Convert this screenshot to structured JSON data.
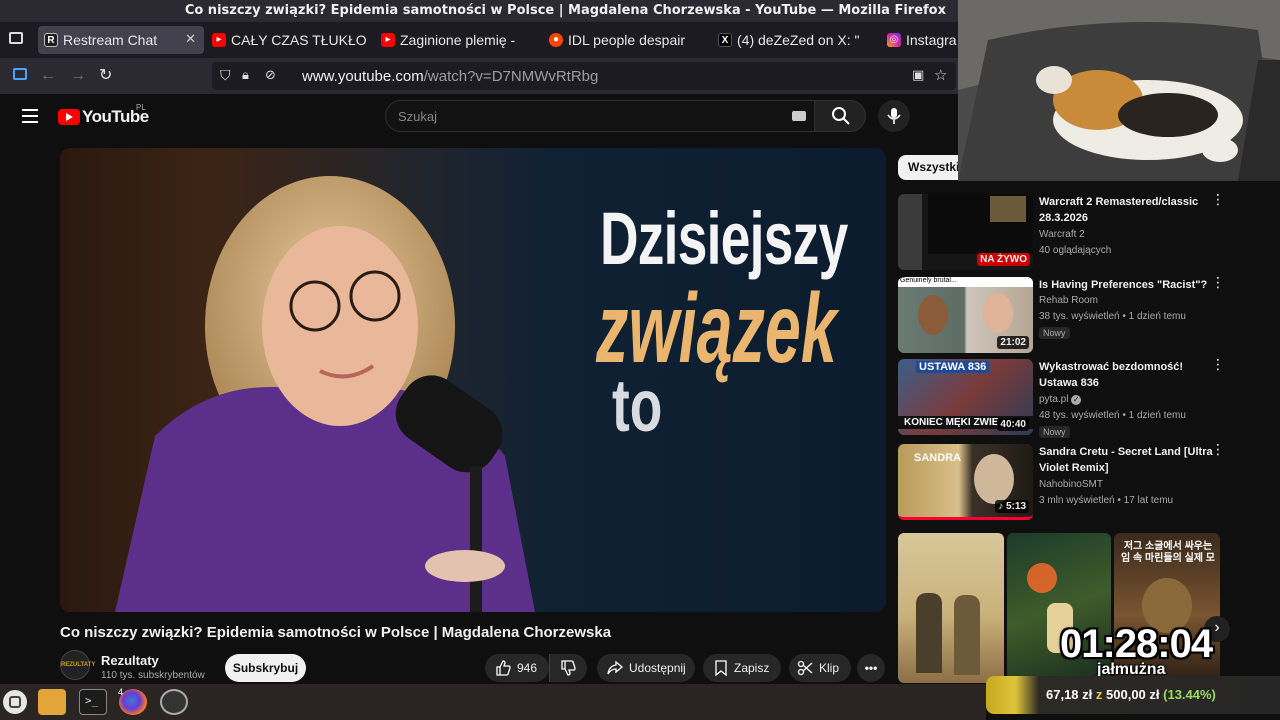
{
  "window": {
    "title": "Co niszczy związki? Epidemia samotności w Polsce | Magdalena Chorzewska - YouTube — Mozilla Firefox"
  },
  "tabs": [
    {
      "label": "Restream Chat",
      "favicon": "restream",
      "color": "#1f1f1f"
    },
    {
      "label": "CAŁY CZAS TŁUKŁO",
      "favicon": "youtube",
      "color": "#ff0000"
    },
    {
      "label": "Zaginione plemię -",
      "favicon": "youtube",
      "color": "#ff0000"
    },
    {
      "label": "IDL people despair",
      "favicon": "reddit",
      "color": "#ff4500"
    },
    {
      "label": "(4) deZeZed on X: \"",
      "favicon": "x",
      "color": "#000000"
    },
    {
      "label": "Instagra",
      "favicon": "instagram",
      "color": "#d6249f"
    }
  ],
  "url": {
    "domain": "www.youtube.com",
    "path": "/watch?v=D7NMWvRtRbg"
  },
  "youtube": {
    "logo_text": "YouTube",
    "region": "PL",
    "search_placeholder": "Szukaj",
    "player": {
      "line1": "Dzisiejszy",
      "line2": "związek",
      "line3": "to"
    },
    "video_title": "Co niszczy związki? Epidemia samotności w Polsce | Magdalena Chorzewska",
    "channel": {
      "name": "Rezultaty",
      "subs": "110 tys. subskrybentów",
      "avatar_text": "REZULTATY"
    },
    "subscribe_label": "Subskrybuj",
    "likes": "946",
    "share_label": "Udostępnij",
    "save_label": "Zapisz",
    "clip_label": "Klip",
    "chip_label": "Wszystkie"
  },
  "recommendations": [
    {
      "title": "Warcraft 2 Remastered/classic 28.3.2026",
      "channel": "Warcraft 2",
      "meta": "40 oglądających",
      "badge": "NA ŻYWO",
      "duration": "",
      "new": ""
    },
    {
      "title": "Is Having Preferences \"Racist\"?",
      "channel": "Rehab Room",
      "meta": "38 tys. wyświetleń • 1 dzień temu",
      "badge": "",
      "duration": "21:02",
      "new": "Nowy",
      "thumb_text": "Genuinely brutal..."
    },
    {
      "title": "Wykastrować bezdomność! Ustawa 836",
      "channel": "pyta.pl",
      "meta": "48 tys. wyświetleń • 1 dzień temu",
      "badge": "",
      "duration": "40:40",
      "new": "Nowy",
      "thumb_text_top": "USTAWA 836",
      "thumb_text_bottom": "KONIEC MĘKI ZWIE"
    },
    {
      "title": "Sandra Cretu - Secret Land [Ultra Violet Remix]",
      "channel": "NahobinoSMT",
      "meta": "3 mln wyświetleń • 17 lat temu",
      "badge": "",
      "duration": "5:13",
      "new": "",
      "thumb_text": "SANDRA"
    }
  ],
  "shorts_third_text": "저그 소굴에서 싸우는 임 속 마린들의 실제 모",
  "stream": {
    "timer": "01:28:04",
    "timer_label": "jałmużna",
    "donation_current": "67,18 zł",
    "donation_sep": "z",
    "donation_goal": "500,00 zł",
    "donation_pct": "(13.44%)",
    "donation_fraction": 0.1344
  },
  "taskbar": {
    "firefox_count": "4"
  }
}
